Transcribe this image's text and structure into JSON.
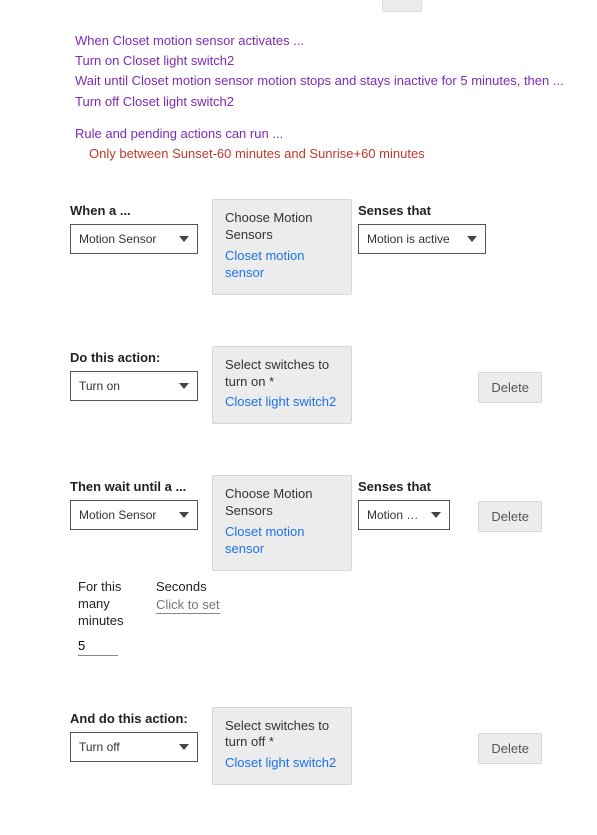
{
  "summary": {
    "line1": "When Closet motion sensor activates ...",
    "line2": "Turn on Closet light switch2",
    "line3": "Wait until Closet motion sensor motion stops and stays inactive for 5 minutes, then ...",
    "line4": "Turn off Closet light switch2",
    "cond_title": "Rule and pending actions can run ...",
    "cond_sub": "Only between Sunset-60 minutes and Sunrise+60 minutes"
  },
  "when": {
    "label": "When a ...",
    "select_value": "Motion Sensor",
    "card_title": "Choose Motion Sensors",
    "card_link": "Closet motion sensor",
    "senses_label": "Senses that",
    "senses_value": "Motion is active"
  },
  "action1": {
    "label": "Do this action:",
    "select_value": "Turn on",
    "card_title": "Select switches to turn on *",
    "card_link": "Closet light switch2",
    "delete": "Delete"
  },
  "wait": {
    "label": "Then wait until a ...",
    "select_value": "Motion Sensor",
    "card_title": "Choose Motion Sensors",
    "card_link": "Closet motion sensor",
    "senses_label": "Senses that",
    "senses_value": "Motion h…",
    "delete": "Delete"
  },
  "duration": {
    "min_label": "For this many minutes",
    "min_value": "5",
    "sec_label": "Seconds",
    "sec_placeholder": "Click to set"
  },
  "action2": {
    "label": "And do this action:",
    "select_value": "Turn off",
    "card_title": "Select switches to turn off *",
    "card_link": "Closet light switch2",
    "delete": "Delete"
  }
}
